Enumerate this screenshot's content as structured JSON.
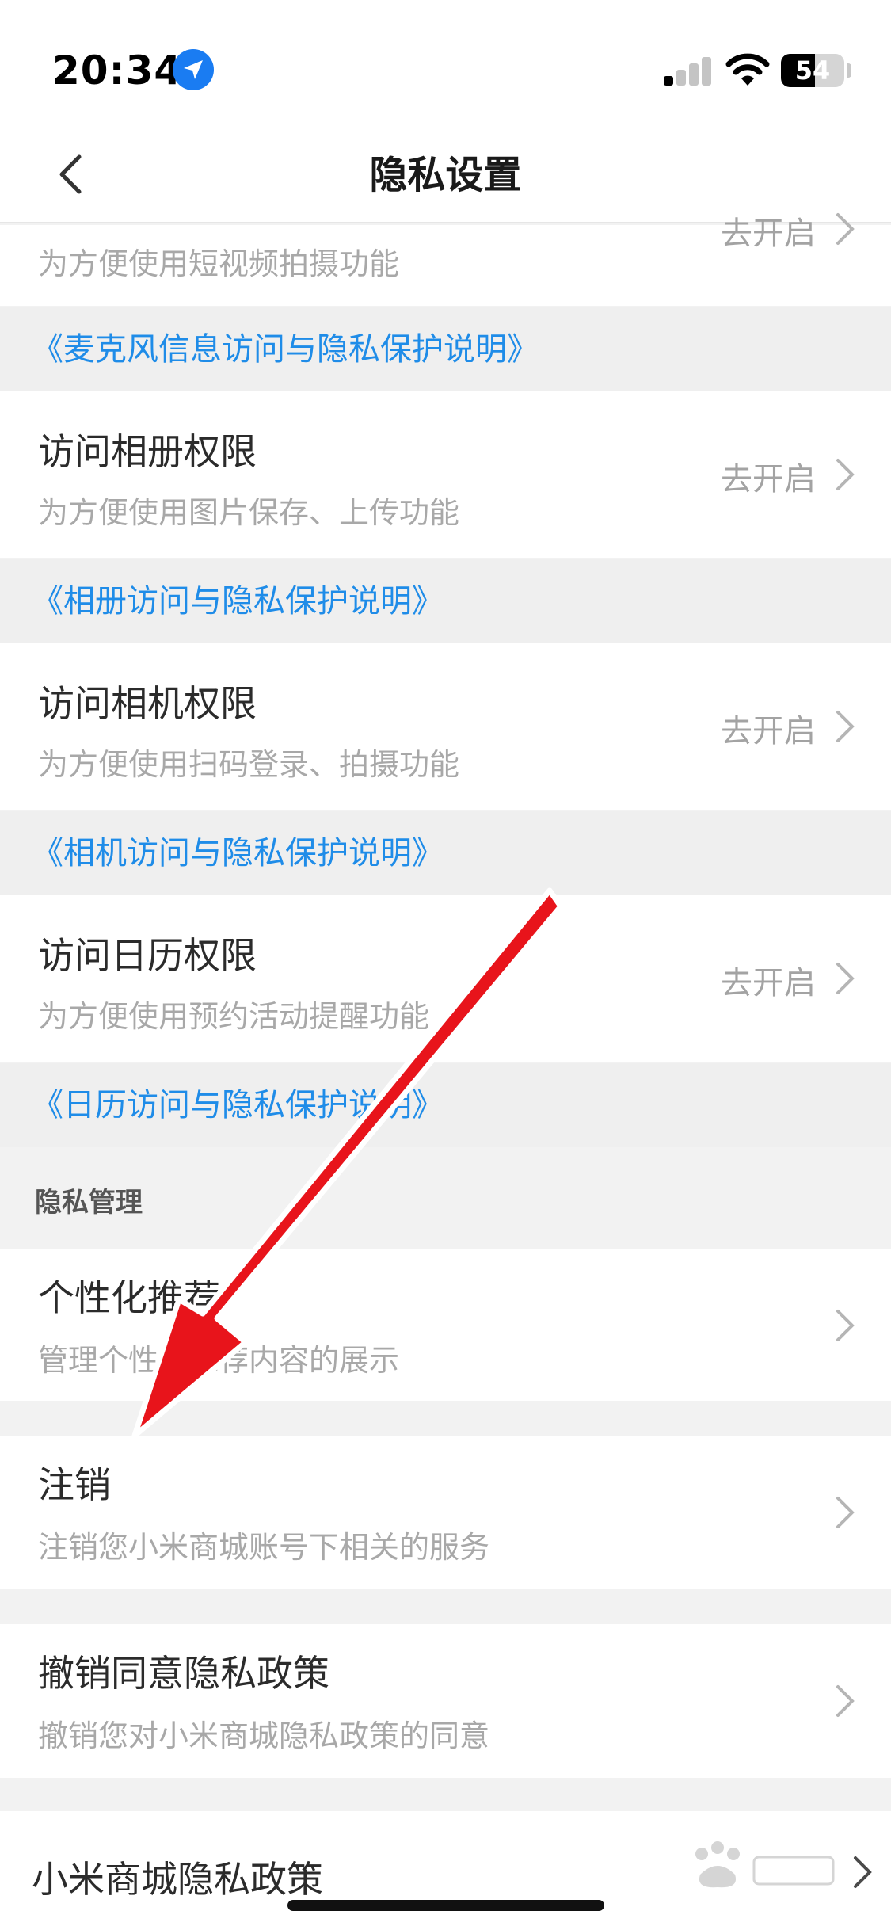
{
  "status_bar": {
    "time": "20:34",
    "battery": "54"
  },
  "header": {
    "title": "隐私设置"
  },
  "partial_row": {
    "action": "去开启",
    "subtitle": "为方便使用短视频拍摄功能"
  },
  "links": {
    "microphone": "《麦克风信息访问与隐私保护说明》",
    "album": "《相册访问与隐私保护说明》",
    "camera": "《相机访问与隐私保护说明》",
    "calendar": "《日历访问与隐私保护说明》"
  },
  "permissions": [
    {
      "title": "访问相册权限",
      "subtitle": "为方便使用图片保存、上传功能",
      "action": "去开启"
    },
    {
      "title": "访问相机权限",
      "subtitle": "为方便使用扫码登录、拍摄功能",
      "action": "去开启"
    },
    {
      "title": "访问日历权限",
      "subtitle": "为方便使用预约活动提醒功能",
      "action": "去开启"
    }
  ],
  "privacy_section": {
    "label": "隐私管理"
  },
  "management": [
    {
      "title": "个性化推荐",
      "subtitle": "管理个性化推荐内容的展示"
    },
    {
      "title": "注销",
      "subtitle": "注销您小米商城账号下相关的服务"
    },
    {
      "title": "撤销同意隐私政策",
      "subtitle": "撤销您对小米商城隐私政策的同意"
    }
  ],
  "policy_row": {
    "title": "小米商城隐私政策"
  },
  "colors": {
    "link": "#1f8ce8",
    "arrow": "#e8141b",
    "accent_blue": "#1a7cf2"
  }
}
